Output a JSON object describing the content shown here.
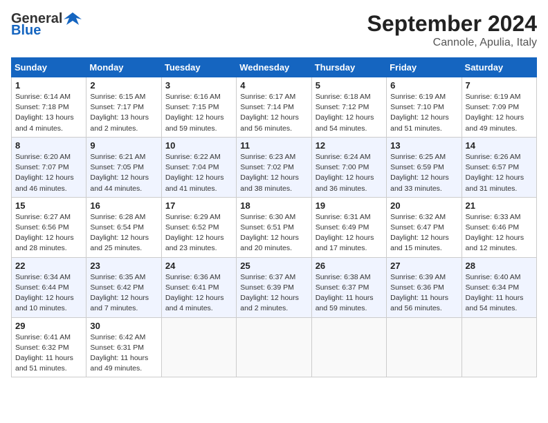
{
  "logo": {
    "text_general": "General",
    "text_blue": "Blue"
  },
  "title": "September 2024",
  "location": "Cannole, Apulia, Italy",
  "days_of_week": [
    "Sunday",
    "Monday",
    "Tuesday",
    "Wednesday",
    "Thursday",
    "Friday",
    "Saturday"
  ],
  "weeks": [
    [
      {
        "day": "1",
        "sunrise": "6:14 AM",
        "sunset": "7:18 PM",
        "daylight": "13 hours and 4 minutes."
      },
      {
        "day": "2",
        "sunrise": "6:15 AM",
        "sunset": "7:17 PM",
        "daylight": "13 hours and 2 minutes."
      },
      {
        "day": "3",
        "sunrise": "6:16 AM",
        "sunset": "7:15 PM",
        "daylight": "12 hours and 59 minutes."
      },
      {
        "day": "4",
        "sunrise": "6:17 AM",
        "sunset": "7:14 PM",
        "daylight": "12 hours and 56 minutes."
      },
      {
        "day": "5",
        "sunrise": "6:18 AM",
        "sunset": "7:12 PM",
        "daylight": "12 hours and 54 minutes."
      },
      {
        "day": "6",
        "sunrise": "6:19 AM",
        "sunset": "7:10 PM",
        "daylight": "12 hours and 51 minutes."
      },
      {
        "day": "7",
        "sunrise": "6:19 AM",
        "sunset": "7:09 PM",
        "daylight": "12 hours and 49 minutes."
      }
    ],
    [
      {
        "day": "8",
        "sunrise": "6:20 AM",
        "sunset": "7:07 PM",
        "daylight": "12 hours and 46 minutes."
      },
      {
        "day": "9",
        "sunrise": "6:21 AM",
        "sunset": "7:05 PM",
        "daylight": "12 hours and 44 minutes."
      },
      {
        "day": "10",
        "sunrise": "6:22 AM",
        "sunset": "7:04 PM",
        "daylight": "12 hours and 41 minutes."
      },
      {
        "day": "11",
        "sunrise": "6:23 AM",
        "sunset": "7:02 PM",
        "daylight": "12 hours and 38 minutes."
      },
      {
        "day": "12",
        "sunrise": "6:24 AM",
        "sunset": "7:00 PM",
        "daylight": "12 hours and 36 minutes."
      },
      {
        "day": "13",
        "sunrise": "6:25 AM",
        "sunset": "6:59 PM",
        "daylight": "12 hours and 33 minutes."
      },
      {
        "day": "14",
        "sunrise": "6:26 AM",
        "sunset": "6:57 PM",
        "daylight": "12 hours and 31 minutes."
      }
    ],
    [
      {
        "day": "15",
        "sunrise": "6:27 AM",
        "sunset": "6:56 PM",
        "daylight": "12 hours and 28 minutes."
      },
      {
        "day": "16",
        "sunrise": "6:28 AM",
        "sunset": "6:54 PM",
        "daylight": "12 hours and 25 minutes."
      },
      {
        "day": "17",
        "sunrise": "6:29 AM",
        "sunset": "6:52 PM",
        "daylight": "12 hours and 23 minutes."
      },
      {
        "day": "18",
        "sunrise": "6:30 AM",
        "sunset": "6:51 PM",
        "daylight": "12 hours and 20 minutes."
      },
      {
        "day": "19",
        "sunrise": "6:31 AM",
        "sunset": "6:49 PM",
        "daylight": "12 hours and 17 minutes."
      },
      {
        "day": "20",
        "sunrise": "6:32 AM",
        "sunset": "6:47 PM",
        "daylight": "12 hours and 15 minutes."
      },
      {
        "day": "21",
        "sunrise": "6:33 AM",
        "sunset": "6:46 PM",
        "daylight": "12 hours and 12 minutes."
      }
    ],
    [
      {
        "day": "22",
        "sunrise": "6:34 AM",
        "sunset": "6:44 PM",
        "daylight": "12 hours and 10 minutes."
      },
      {
        "day": "23",
        "sunrise": "6:35 AM",
        "sunset": "6:42 PM",
        "daylight": "12 hours and 7 minutes."
      },
      {
        "day": "24",
        "sunrise": "6:36 AM",
        "sunset": "6:41 PM",
        "daylight": "12 hours and 4 minutes."
      },
      {
        "day": "25",
        "sunrise": "6:37 AM",
        "sunset": "6:39 PM",
        "daylight": "12 hours and 2 minutes."
      },
      {
        "day": "26",
        "sunrise": "6:38 AM",
        "sunset": "6:37 PM",
        "daylight": "11 hours and 59 minutes."
      },
      {
        "day": "27",
        "sunrise": "6:39 AM",
        "sunset": "6:36 PM",
        "daylight": "11 hours and 56 minutes."
      },
      {
        "day": "28",
        "sunrise": "6:40 AM",
        "sunset": "6:34 PM",
        "daylight": "11 hours and 54 minutes."
      }
    ],
    [
      {
        "day": "29",
        "sunrise": "6:41 AM",
        "sunset": "6:32 PM",
        "daylight": "11 hours and 51 minutes."
      },
      {
        "day": "30",
        "sunrise": "6:42 AM",
        "sunset": "6:31 PM",
        "daylight": "11 hours and 49 minutes."
      },
      null,
      null,
      null,
      null,
      null
    ]
  ],
  "labels": {
    "sunrise": "Sunrise:",
    "sunset": "Sunset:",
    "daylight": "Daylight:"
  }
}
